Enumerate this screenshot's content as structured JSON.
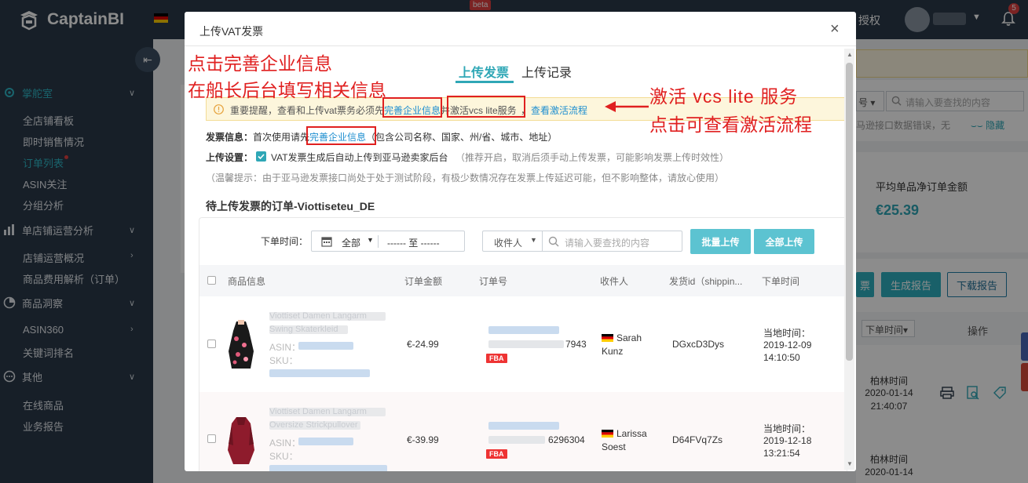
{
  "app": {
    "brand": "CaptainBI",
    "beta": "beta",
    "auth_label": "授权",
    "notifications": "5"
  },
  "sidebar": {
    "groups": [
      {
        "label": "掌舵室",
        "icon": "gear-icon"
      },
      {
        "label": "单店铺运营分析",
        "icon": "bar-chart-icon"
      },
      {
        "label": "商品洞察",
        "icon": "pie-chart-icon"
      },
      {
        "label": "其他",
        "icon": "more-icon"
      }
    ],
    "items": [
      "全店铺看板",
      "即时销售情况",
      "订单列表",
      "ASIN关注",
      "分组分析",
      "店铺运营概况",
      "商品费用解析（订单）",
      "ASIN360",
      "关键词排名",
      "在线商品",
      "业务报告"
    ]
  },
  "background": {
    "search_prefix": "号",
    "search_placeholder": "请输入要查找的内容",
    "warning_text": "马逊接口数据错误，无",
    "hide_label": "隐藏",
    "stat_label": "平均单品净订单金额",
    "stat_value": "€25.39",
    "btn_partial": "票",
    "btn_generate": "生成报告",
    "btn_download": "下载报告",
    "col_order_time": "下单时间",
    "col_operation": "操作",
    "rows": [
      {
        "tz": "柏林时间",
        "date": "2020-01-14",
        "time": "21:40:07"
      },
      {
        "tz": "柏林时间",
        "date": "2020-01-14"
      }
    ]
  },
  "modal": {
    "title": "上传VAT发票",
    "close": "×",
    "tabs": [
      "上传发票",
      "上传记录"
    ],
    "notice": {
      "prefix": "重要提醒，查看和上传vat票务必须先",
      "link1": "完善企业信息",
      "mid": "并",
      "mid2": "激活vcs lite服务",
      "mid3": "，",
      "link2": "查看激活流程"
    },
    "invoice_info": {
      "label": "发票信息：",
      "text1": "首次使用请先",
      "link": "完善企业信息",
      "text2": "（包含公司名称、国家、州/省、城市、地址）"
    },
    "upload_setting": {
      "label": "上传设置：",
      "text": "VAT发票生成后自动上传到亚马逊卖家后台",
      "note": "（推荐开启，取消后须手动上传发票，可能影响发票上传时效性）"
    },
    "hint": "（温馨提示：由于亚马逊发票接口尚处于处于测试阶段，有极少数情况存在发票上传延迟可能，但不影响整体，请放心使用）",
    "section_title": "待上传发票的订单-Viottiseteu_DE",
    "filters": {
      "date_label": "下单时间：",
      "date_value": "全部",
      "date_range": "------ 至 ------",
      "receiver": "收件人",
      "search_placeholder": "请输入要查找的内容",
      "btn_batch": "批量上传",
      "btn_all": "全部上传"
    },
    "table": {
      "headers": [
        "商品信息",
        "订单金额",
        "订单号",
        "收件人",
        "发货id（shippin...",
        "下单时间"
      ],
      "rows": [
        {
          "title_line1": "Viottiset Damen Langarm",
          "title_line2": "Swing Skaterkleid",
          "asin_label": "ASIN：",
          "sku_label": "SKU：",
          "amount": "€-24.99",
          "order_suffix": "7943",
          "fba": "FBA",
          "receiver1": "Sarah",
          "receiver2": "Kunz",
          "shipping_id": "DGxcD3Dys",
          "time_label": "当地时间：",
          "date": "2019-12-09",
          "time": "14:10:50"
        },
        {
          "title_line1": "Viottiset Damen Langarm",
          "title_line2": "Oversize Strickpullover",
          "asin_label": "ASIN：",
          "sku_label": "SKU：",
          "amount": "€-39.99",
          "order_suffix": "6296304",
          "fba": "FBA",
          "receiver1": "Larissa",
          "receiver2": "Soest",
          "shipping_id": "D64FVq7Zs",
          "time_label": "当地时间：",
          "date": "2019-12-18",
          "time": "13:21:54"
        }
      ]
    }
  },
  "annotations": {
    "left_line1": "点击完善企业信息",
    "left_line2": "在船长后台填写相关信息",
    "right_line1": "激活 vcs lite 服务",
    "right_line2": "点击可查看激活流程"
  },
  "colors": {
    "accent": "#2fa7b6",
    "annotation": "#e02020",
    "sidebar": "#2a3a4a"
  }
}
